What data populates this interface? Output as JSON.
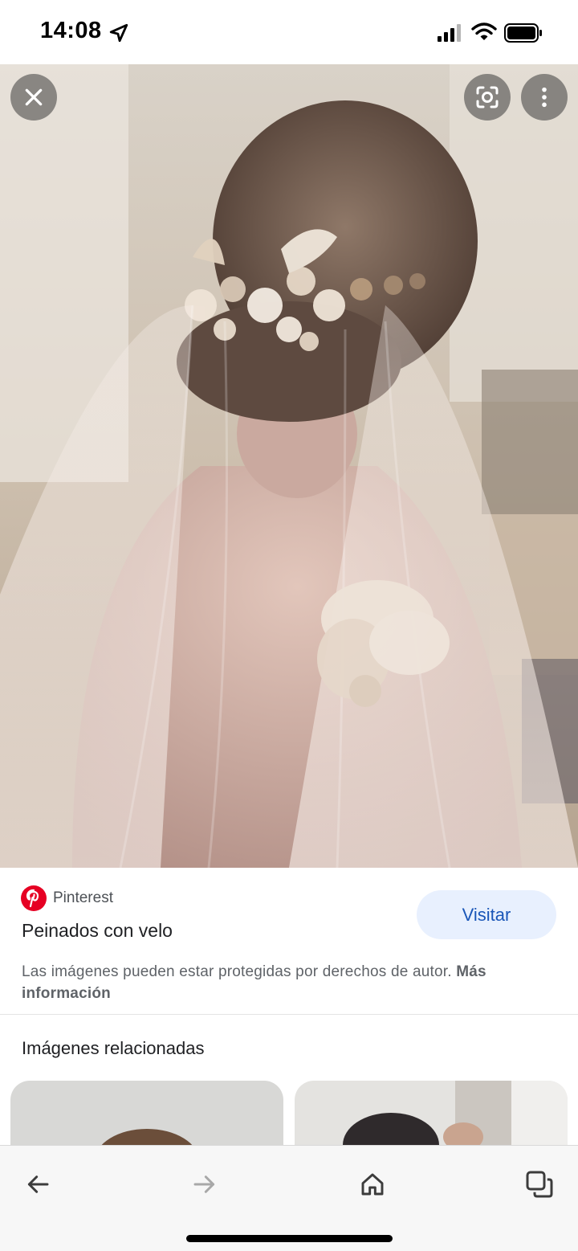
{
  "status_bar": {
    "time": "14:08"
  },
  "source": {
    "name": "Pinterest"
  },
  "result": {
    "title": "Peinados con velo",
    "visit_label": "Visitar",
    "copyright_text": "Las imágenes pueden estar protegidas por derechos de autor.",
    "more_info_label": "Más información"
  },
  "related": {
    "title": "Imágenes relacionadas"
  },
  "colors": {
    "accent": "#1a56b8",
    "visit_bg": "#e8f0fe",
    "pinterest": "#e60023"
  },
  "icons": [
    "location-arrow-icon",
    "signal-icon",
    "wifi-icon",
    "battery-icon",
    "close-icon",
    "lens-icon",
    "more-vert-icon",
    "back-arrow-icon",
    "forward-arrow-icon",
    "home-icon",
    "tabs-icon"
  ]
}
